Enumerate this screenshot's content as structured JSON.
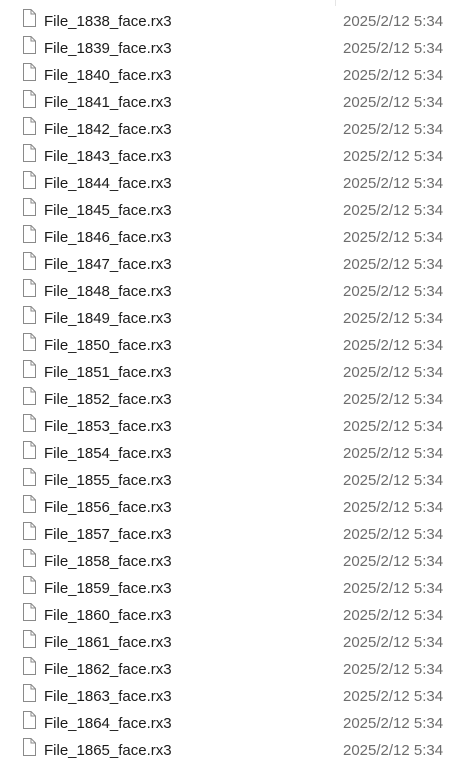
{
  "files": [
    {
      "name": "File_1838_face.rx3",
      "modified": "2025/2/12 5:34",
      "icon": "document-icon"
    },
    {
      "name": "File_1839_face.rx3",
      "modified": "2025/2/12 5:34",
      "icon": "document-icon"
    },
    {
      "name": "File_1840_face.rx3",
      "modified": "2025/2/12 5:34",
      "icon": "document-icon"
    },
    {
      "name": "File_1841_face.rx3",
      "modified": "2025/2/12 5:34",
      "icon": "document-icon"
    },
    {
      "name": "File_1842_face.rx3",
      "modified": "2025/2/12 5:34",
      "icon": "document-icon"
    },
    {
      "name": "File_1843_face.rx3",
      "modified": "2025/2/12 5:34",
      "icon": "document-icon"
    },
    {
      "name": "File_1844_face.rx3",
      "modified": "2025/2/12 5:34",
      "icon": "document-icon"
    },
    {
      "name": "File_1845_face.rx3",
      "modified": "2025/2/12 5:34",
      "icon": "document-icon"
    },
    {
      "name": "File_1846_face.rx3",
      "modified": "2025/2/12 5:34",
      "icon": "document-icon"
    },
    {
      "name": "File_1847_face.rx3",
      "modified": "2025/2/12 5:34",
      "icon": "document-icon"
    },
    {
      "name": "File_1848_face.rx3",
      "modified": "2025/2/12 5:34",
      "icon": "document-icon"
    },
    {
      "name": "File_1849_face.rx3",
      "modified": "2025/2/12 5:34",
      "icon": "document-icon"
    },
    {
      "name": "File_1850_face.rx3",
      "modified": "2025/2/12 5:34",
      "icon": "document-icon"
    },
    {
      "name": "File_1851_face.rx3",
      "modified": "2025/2/12 5:34",
      "icon": "document-icon"
    },
    {
      "name": "File_1852_face.rx3",
      "modified": "2025/2/12 5:34",
      "icon": "document-icon"
    },
    {
      "name": "File_1853_face.rx3",
      "modified": "2025/2/12 5:34",
      "icon": "document-icon"
    },
    {
      "name": "File_1854_face.rx3",
      "modified": "2025/2/12 5:34",
      "icon": "document-icon"
    },
    {
      "name": "File_1855_face.rx3",
      "modified": "2025/2/12 5:34",
      "icon": "document-icon"
    },
    {
      "name": "File_1856_face.rx3",
      "modified": "2025/2/12 5:34",
      "icon": "document-icon"
    },
    {
      "name": "File_1857_face.rx3",
      "modified": "2025/2/12 5:34",
      "icon": "document-icon"
    },
    {
      "name": "File_1858_face.rx3",
      "modified": "2025/2/12 5:34",
      "icon": "document-icon"
    },
    {
      "name": "File_1859_face.rx3",
      "modified": "2025/2/12 5:34",
      "icon": "document-icon"
    },
    {
      "name": "File_1860_face.rx3",
      "modified": "2025/2/12 5:34",
      "icon": "document-icon"
    },
    {
      "name": "File_1861_face.rx3",
      "modified": "2025/2/12 5:34",
      "icon": "document-icon"
    },
    {
      "name": "File_1862_face.rx3",
      "modified": "2025/2/12 5:34",
      "icon": "document-icon"
    },
    {
      "name": "File_1863_face.rx3",
      "modified": "2025/2/12 5:34",
      "icon": "document-icon"
    },
    {
      "name": "File_1864_face.rx3",
      "modified": "2025/2/12 5:34",
      "icon": "document-icon"
    },
    {
      "name": "File_1865_face.rx3",
      "modified": "2025/2/12 5:34",
      "icon": "document-icon"
    }
  ],
  "colors": {
    "name_text": "#1a1a1a",
    "date_text": "#6d6d6d",
    "icon_stroke": "#8a8a8a",
    "background": "#ffffff"
  }
}
